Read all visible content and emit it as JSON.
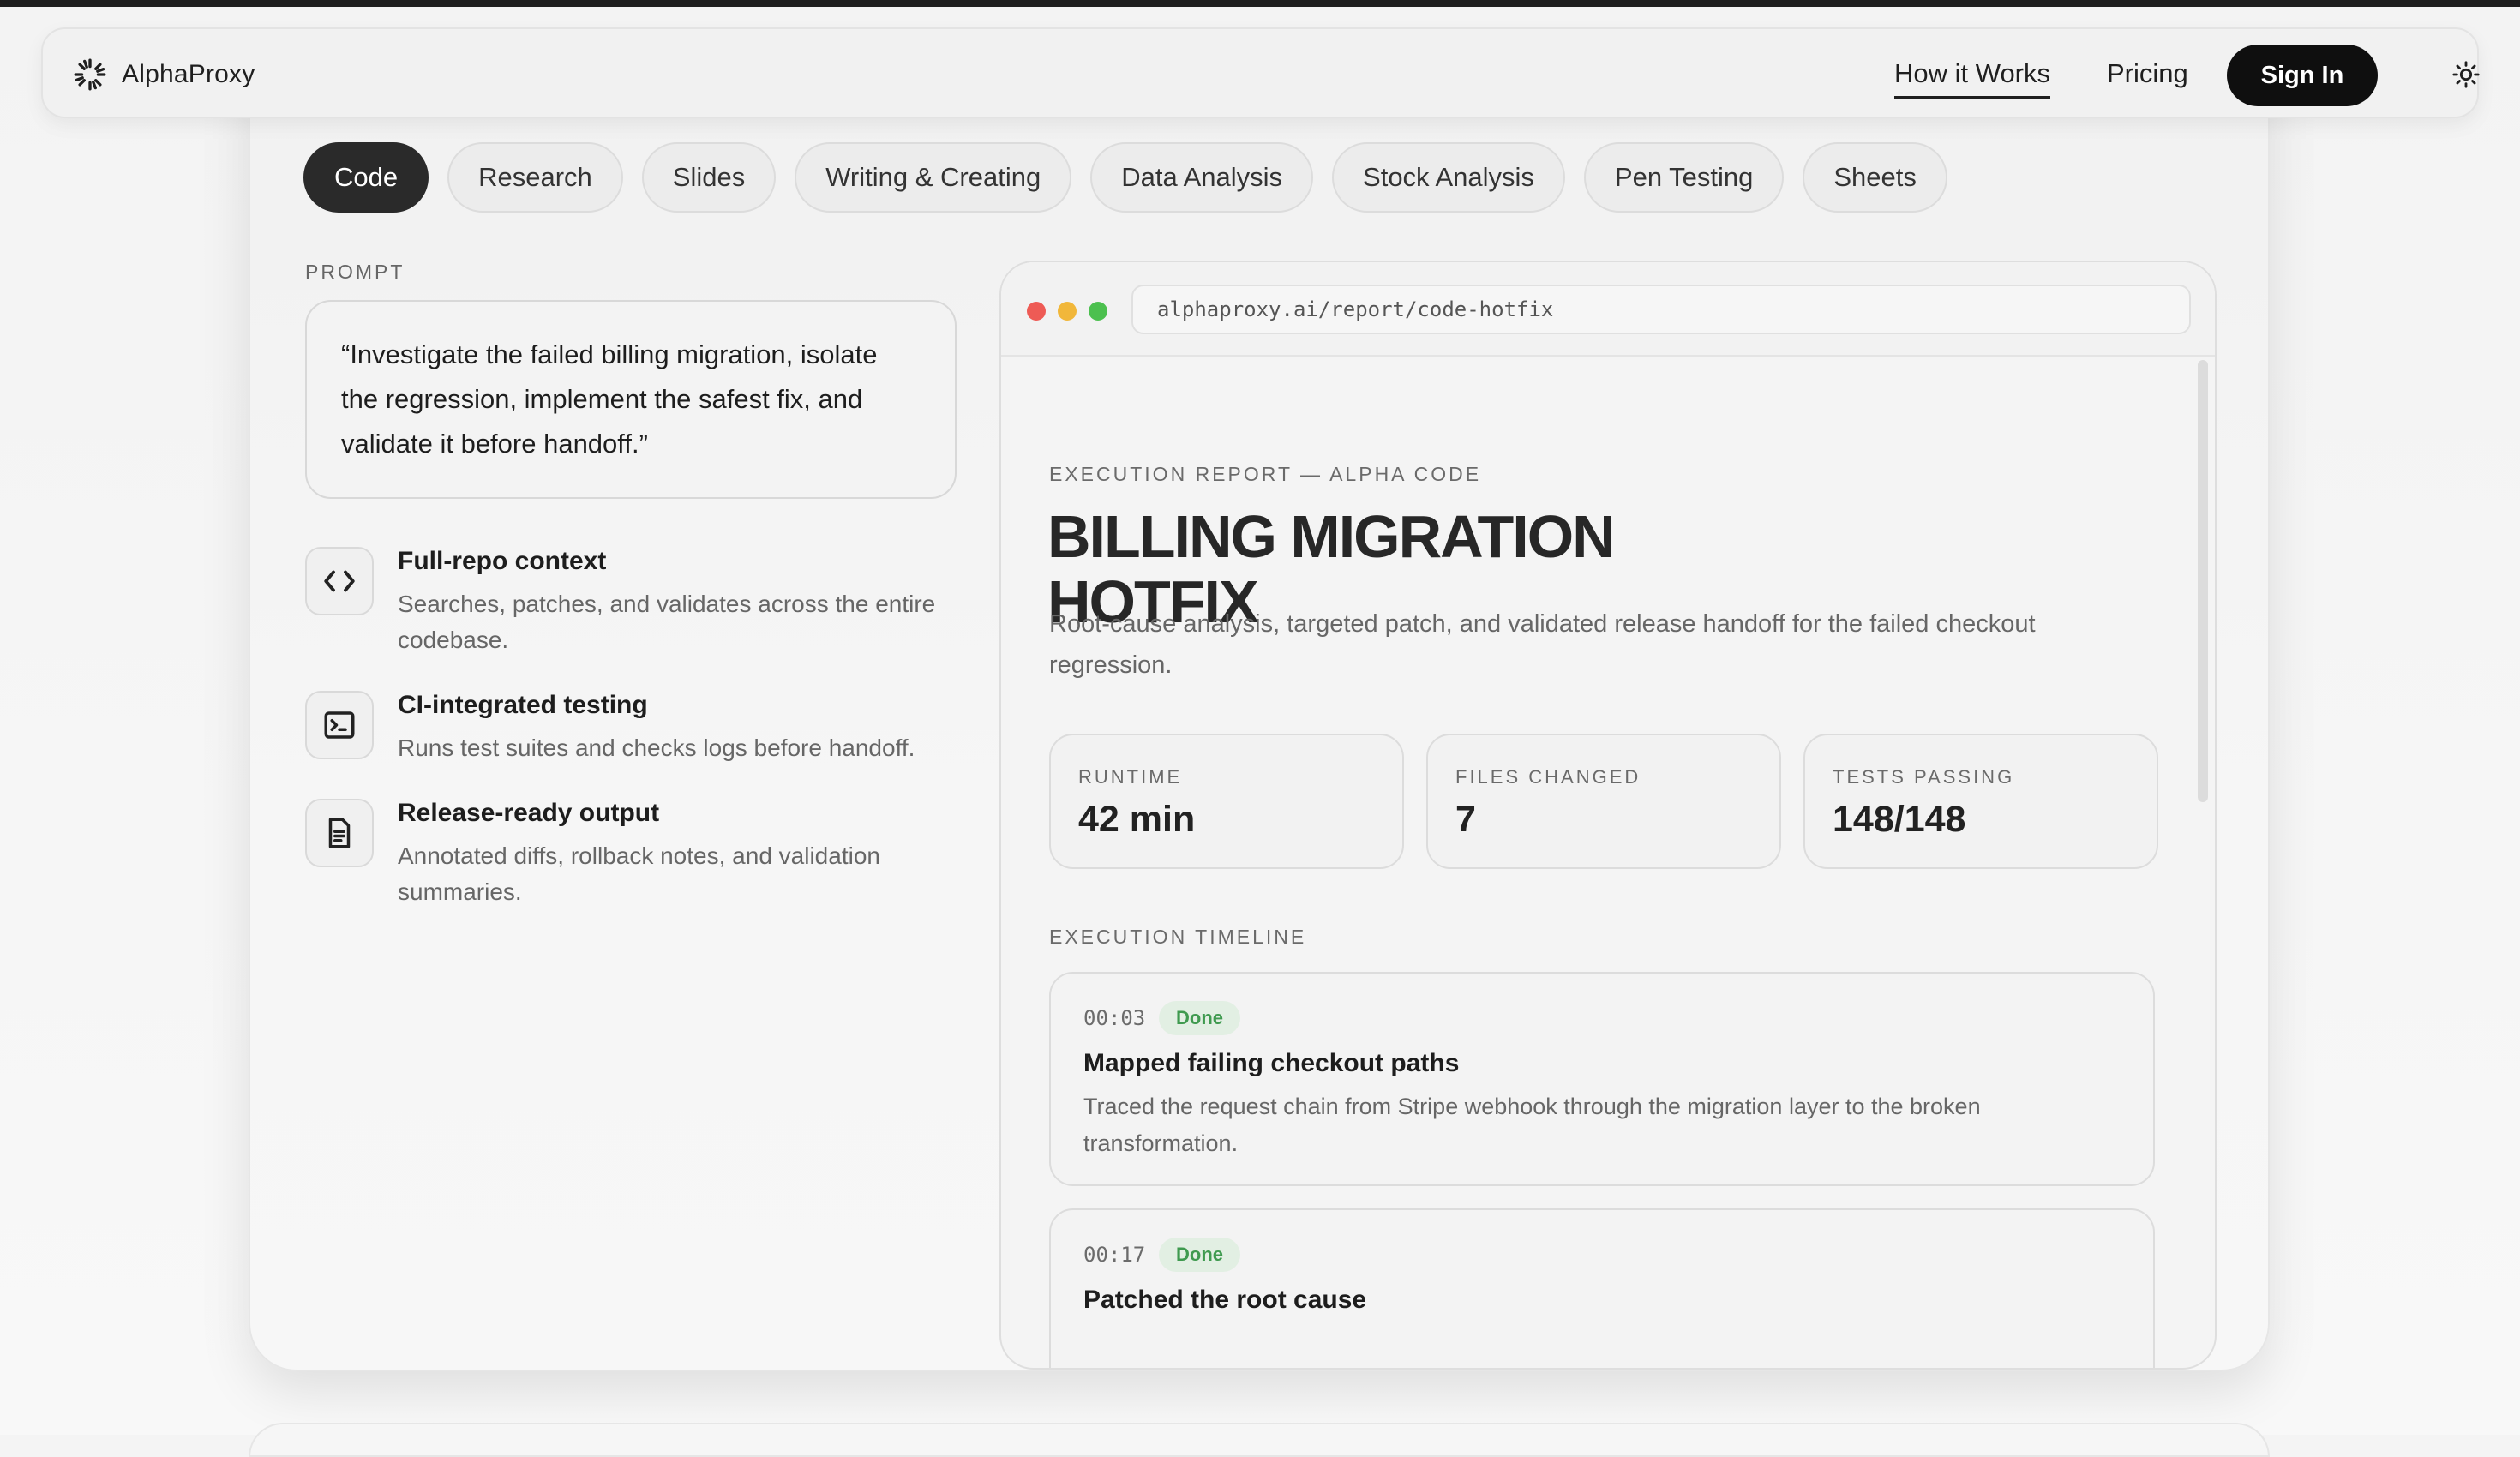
{
  "brand": {
    "name": "AlphaProxy",
    "logo_icon": "burst-logo-icon"
  },
  "nav": {
    "links": [
      {
        "label": "How it Works",
        "active": true
      },
      {
        "label": "Pricing",
        "active": false
      }
    ],
    "signin_label": "Sign In",
    "theme_icon": "sun-icon"
  },
  "tabs": [
    {
      "label": "Code",
      "active": true
    },
    {
      "label": "Research",
      "active": false
    },
    {
      "label": "Slides",
      "active": false
    },
    {
      "label": "Writing & Creating",
      "active": false
    },
    {
      "label": "Data Analysis",
      "active": false
    },
    {
      "label": "Stock Analysis",
      "active": false
    },
    {
      "label": "Pen Testing",
      "active": false
    },
    {
      "label": "Sheets",
      "active": false
    }
  ],
  "prompt": {
    "label": "PROMPT",
    "text": "“Investigate the failed billing migration, isolate the regression, implement the safest fix, and validate it before handoff.”"
  },
  "features": [
    {
      "icon": "code-brackets-icon",
      "title": "Full-repo context",
      "desc": "Searches, patches, and validates across the entire codebase."
    },
    {
      "icon": "terminal-icon",
      "title": "CI-integrated testing",
      "desc": "Runs test suites and checks logs before handoff."
    },
    {
      "icon": "document-icon",
      "title": "Release-ready output",
      "desc": "Annotated diffs, rollback notes, and validation summaries."
    }
  ],
  "browser": {
    "url": "alphaproxy.ai/report/code-hotfix",
    "dot_colors": [
      "#ee5b55",
      "#f1b73a",
      "#4cc04f"
    ]
  },
  "report": {
    "eyebrow": "EXECUTION REPORT — ALPHA CODE",
    "title": "BILLING MIGRATION HOTFIX",
    "description": "Root-cause analysis, targeted patch, and validated release handoff for the failed checkout regression.",
    "stats": [
      {
        "label": "RUNTIME",
        "value": "42 min"
      },
      {
        "label": "FILES CHANGED",
        "value": "7"
      },
      {
        "label": "TESTS PASSING",
        "value": "148/148"
      }
    ],
    "timeline_label": "EXECUTION TIMELINE",
    "timeline": [
      {
        "time": "00:03",
        "status": "Done",
        "title": "Mapped failing checkout paths",
        "desc": "Traced the request chain from Stripe webhook through the migration layer to the broken transformation."
      },
      {
        "time": "00:17",
        "status": "Done",
        "title": "Patched the root cause",
        "desc": ""
      }
    ]
  },
  "colors": {
    "accent": "#0f0f0f",
    "done_green": "#3f9a4f",
    "done_bg": "#e2efe3"
  }
}
